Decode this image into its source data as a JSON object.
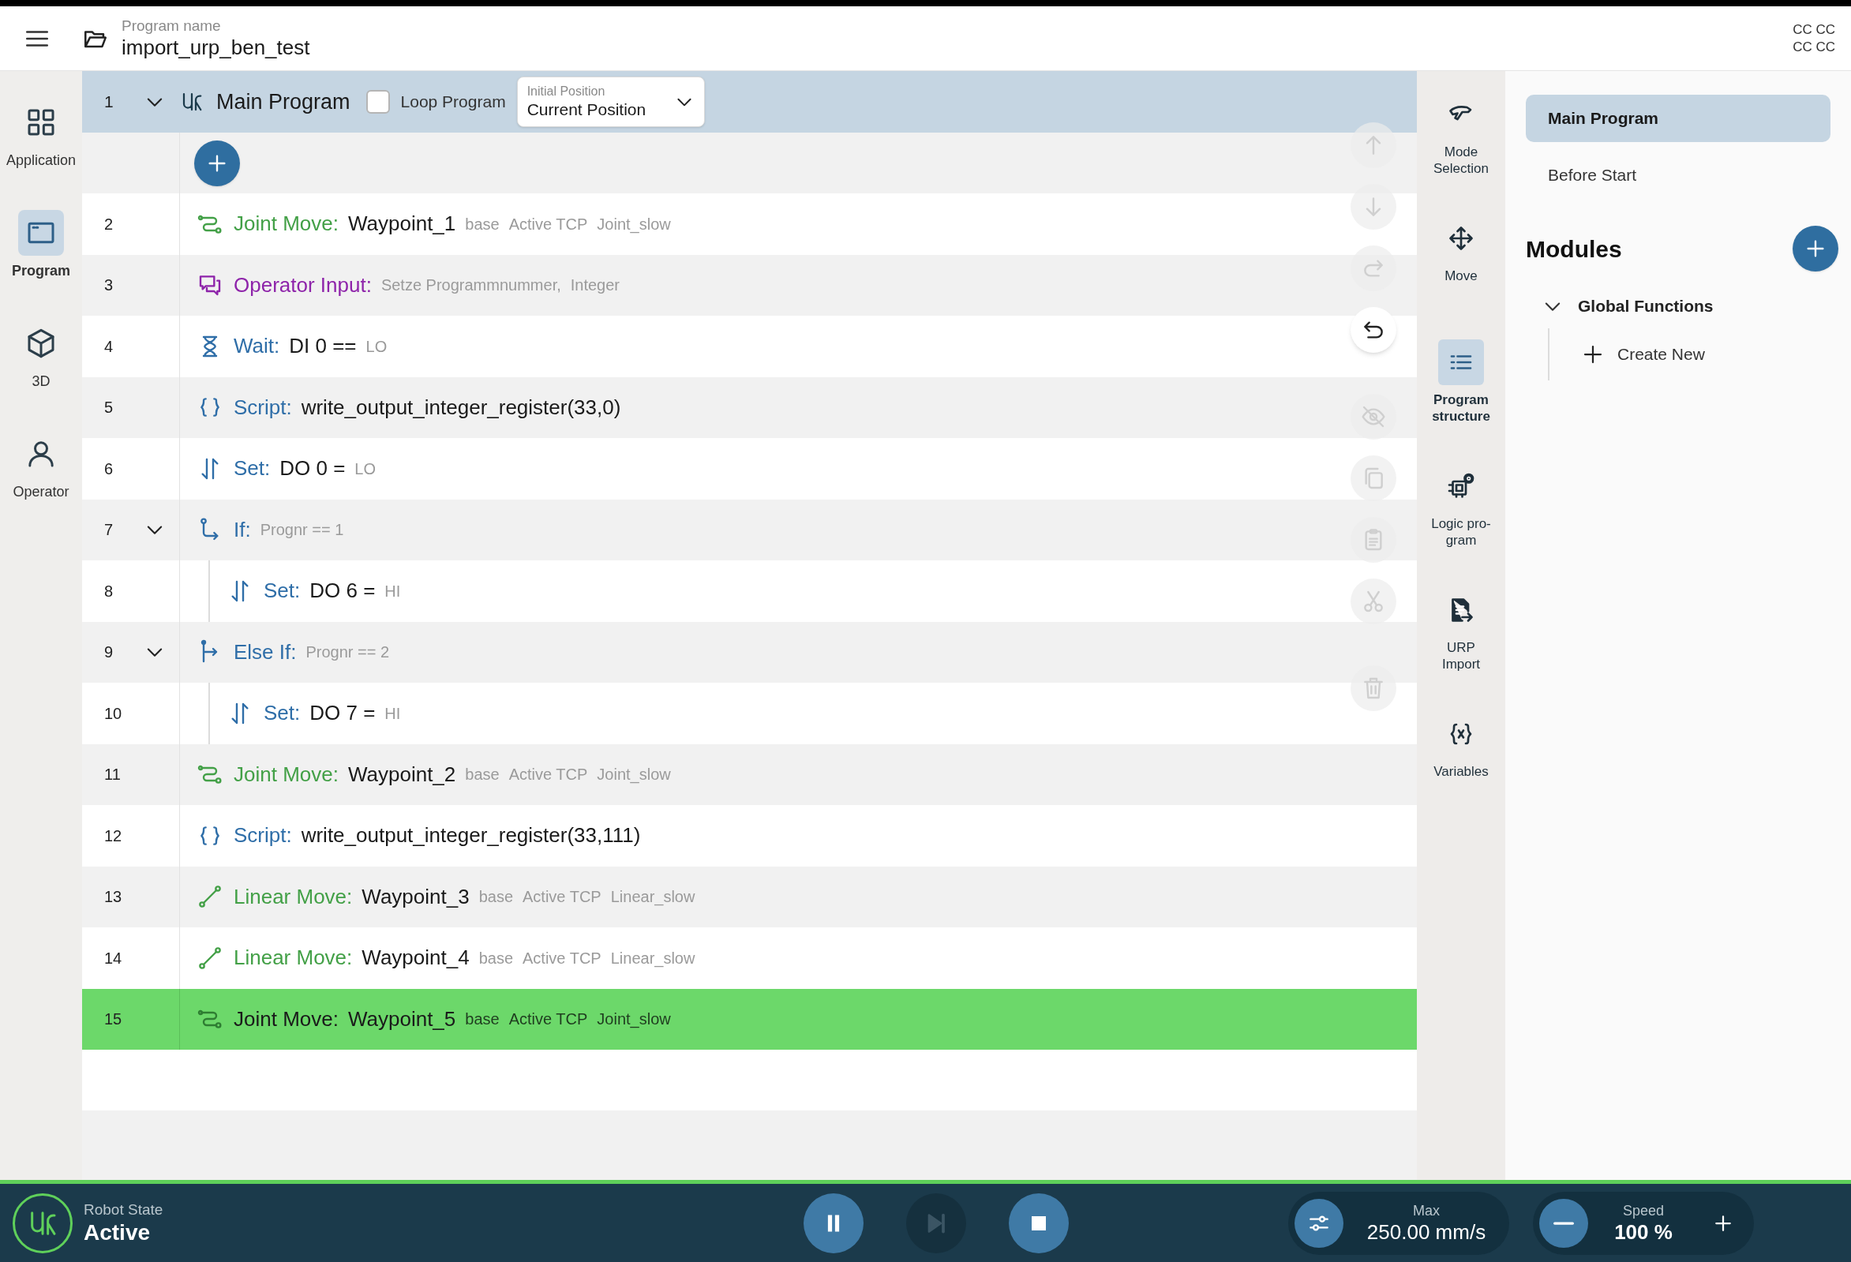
{
  "header": {
    "program_label": "Program name",
    "program_name": "import_urp_ben_test",
    "corner_lines": [
      "CC CC",
      "CC CC"
    ]
  },
  "nav": [
    {
      "label": "Application",
      "kind": "grid",
      "selected": false
    },
    {
      "label": "Program",
      "kind": "window",
      "selected": true
    },
    {
      "label": "3D",
      "kind": "cube",
      "selected": false
    },
    {
      "label": "Operator",
      "kind": "person",
      "selected": false
    }
  ],
  "main_program": {
    "number": "1",
    "expanded": true,
    "title": "Main Program",
    "loop": {
      "label": "Loop Program",
      "checked": false
    },
    "initial_position": {
      "label": "Initial Position",
      "value": "Current Position"
    }
  },
  "rows": [
    {
      "number": "2",
      "kind": "joint_move",
      "label": "Joint Move:",
      "value": "Waypoint_1",
      "params": [
        "base",
        "Active TCP",
        "Joint_slow"
      ],
      "selected": false
    },
    {
      "number": "3",
      "kind": "operator_input",
      "label": "Operator Input:",
      "params": [
        "Setze Programmnummer,",
        "Integer"
      ],
      "selected": false
    },
    {
      "number": "4",
      "kind": "wait",
      "label": "Wait:",
      "value": "DI 0 ==",
      "params": [
        "LO"
      ],
      "selected": false
    },
    {
      "number": "5",
      "kind": "script",
      "label": "Script:",
      "value": "write_output_integer_register(33,0)",
      "selected": false
    },
    {
      "number": "6",
      "kind": "set",
      "label": "Set:",
      "value": "DO 0 =",
      "params": [
        "LO"
      ],
      "selected": false
    },
    {
      "number": "7",
      "kind": "if",
      "label": "If:",
      "params": [
        "Prognr == 1"
      ],
      "expanded": true,
      "selected": false,
      "children": [
        {
          "number": "8",
          "kind": "set",
          "label": "Set:",
          "value": "DO 6 =",
          "params": [
            "HI"
          ],
          "selected": false
        }
      ]
    },
    {
      "number": "9",
      "kind": "else_if",
      "label": "Else If:",
      "params": [
        "Prognr == 2"
      ],
      "expanded": true,
      "selected": false,
      "children": [
        {
          "number": "10",
          "kind": "set",
          "label": "Set:",
          "value": "DO 7 =",
          "params": [
            "HI"
          ],
          "selected": false
        }
      ]
    },
    {
      "number": "11",
      "kind": "joint_move",
      "label": "Joint Move:",
      "value": "Waypoint_2",
      "params": [
        "base",
        "Active TCP",
        "Joint_slow"
      ],
      "selected": false
    },
    {
      "number": "12",
      "kind": "script",
      "label": "Script:",
      "value": "write_output_integer_register(33,111)",
      "selected": false
    },
    {
      "number": "13",
      "kind": "linear_move",
      "label": "Linear Move:",
      "value": "Waypoint_3",
      "params": [
        "base",
        "Active TCP",
        "Linear_slow"
      ],
      "selected": false
    },
    {
      "number": "14",
      "kind": "linear_move",
      "label": "Linear Move:",
      "value": "Waypoint_4",
      "params": [
        "base",
        "Active TCP",
        "Linear_slow"
      ],
      "selected": false
    },
    {
      "number": "15",
      "kind": "joint_move",
      "label": "Joint Move:",
      "value": "Waypoint_5",
      "params": [
        "base",
        "Active TCP",
        "Joint_slow"
      ],
      "selected": true
    }
  ],
  "actions": [
    [
      {
        "kind": "up",
        "disabled": true
      },
      {
        "kind": "down",
        "disabled": true
      },
      {
        "kind": "redo",
        "disabled": true
      },
      {
        "kind": "undo",
        "disabled": false
      }
    ],
    [
      {
        "kind": "hide",
        "disabled": true
      },
      {
        "kind": "copy",
        "disabled": true
      },
      {
        "kind": "paste",
        "disabled": true
      },
      {
        "kind": "cut",
        "disabled": true
      }
    ],
    [
      {
        "kind": "delete",
        "disabled": true
      }
    ]
  ],
  "tools": [
    {
      "label": "Mode\nSelection",
      "kind": "hand",
      "selected": false
    },
    {
      "label": "Move",
      "kind": "move",
      "selected": false
    },
    {
      "label": "Program\nstructure",
      "kind": "list",
      "selected": true
    },
    {
      "label": "Logic pro-\ngram",
      "kind": "logic",
      "selected": false
    },
    {
      "label": "URP\nImport",
      "kind": "import",
      "selected": false
    },
    {
      "label": "Variables",
      "kind": "variables",
      "selected": false
    }
  ],
  "structure": {
    "sections": [
      {
        "label": "Main Program",
        "selected": true
      },
      {
        "label": "Before Start",
        "selected": false
      }
    ],
    "modules_title": "Modules",
    "modules": [
      {
        "label": "Global Functions",
        "expanded": true,
        "children": [
          {
            "label": "Create New",
            "kind": "create"
          }
        ]
      }
    ]
  },
  "status_bar": {
    "robot_state_label": "Robot State",
    "robot_state": "Active",
    "controls": [
      {
        "kind": "pause",
        "disabled": false
      },
      {
        "kind": "step",
        "disabled": true
      },
      {
        "kind": "stop",
        "disabled": false
      }
    ],
    "max": {
      "label": "Max",
      "value": "250.00 mm/s"
    },
    "speed": {
      "label": "Speed",
      "value": "100 %"
    }
  }
}
